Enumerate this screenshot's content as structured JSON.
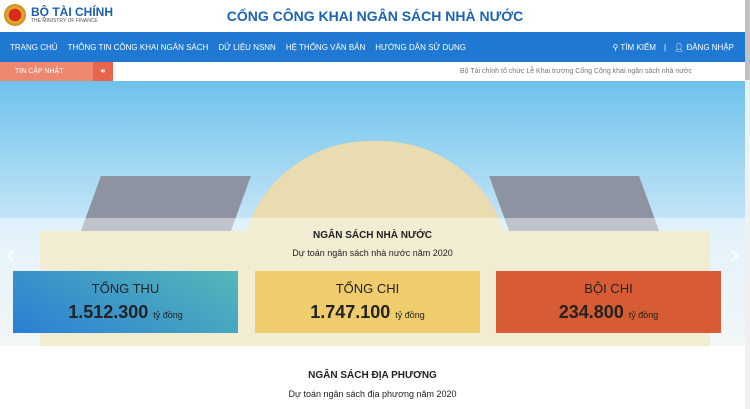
{
  "header": {
    "logo_title": "BỘ TÀI CHÍNH",
    "logo_subtitle": "THE MINISTRY OF FINANCE",
    "site_title": "CỔNG CÔNG KHAI NGÂN SÁCH NHÀ NƯỚC"
  },
  "nav": {
    "items": [
      "TRANG CHỦ",
      "THÔNG TIN CÔNG KHAI NGÂN SÁCH",
      "DỮ LIỆU NSNN",
      "HỆ THỐNG VĂN BẢN",
      "HƯỚNG DẪN SỬ DỤNG"
    ],
    "search": "TÌM KIẾM",
    "separator": "|",
    "login": "ĐĂNG NHẬP"
  },
  "ticker": {
    "label": "TIN CẬP NHẬT",
    "message": "Bộ Tài chính tổ chức Lễ Khai trương Cổng Công khai ngân sách nhà nước"
  },
  "hero": {
    "title": "NGÂN SÁCH NHÀ NƯỚC",
    "subtitle": "Dự toán ngân sách nhà nước năm 2020",
    "cards": [
      {
        "label": "TỔNG THU",
        "value": "1.512.300",
        "unit": "tỷ đồng",
        "color": "#3a9ad0"
      },
      {
        "label": "TỔNG CHI",
        "value": "1.747.100",
        "unit": "tỷ đồng",
        "color": "#f0cd6c"
      },
      {
        "label": "BỘI CHI",
        "value": "234.800",
        "unit": "tỷ đồng",
        "color": "#d85c33"
      }
    ]
  },
  "local": {
    "title": "NGÂN SÁCH ĐỊA PHƯƠNG",
    "subtitle": "Dự toán ngân sách địa phương năm 2020"
  },
  "colors": {
    "nav": "#1f78d1",
    "ticker": "#ee876f"
  }
}
